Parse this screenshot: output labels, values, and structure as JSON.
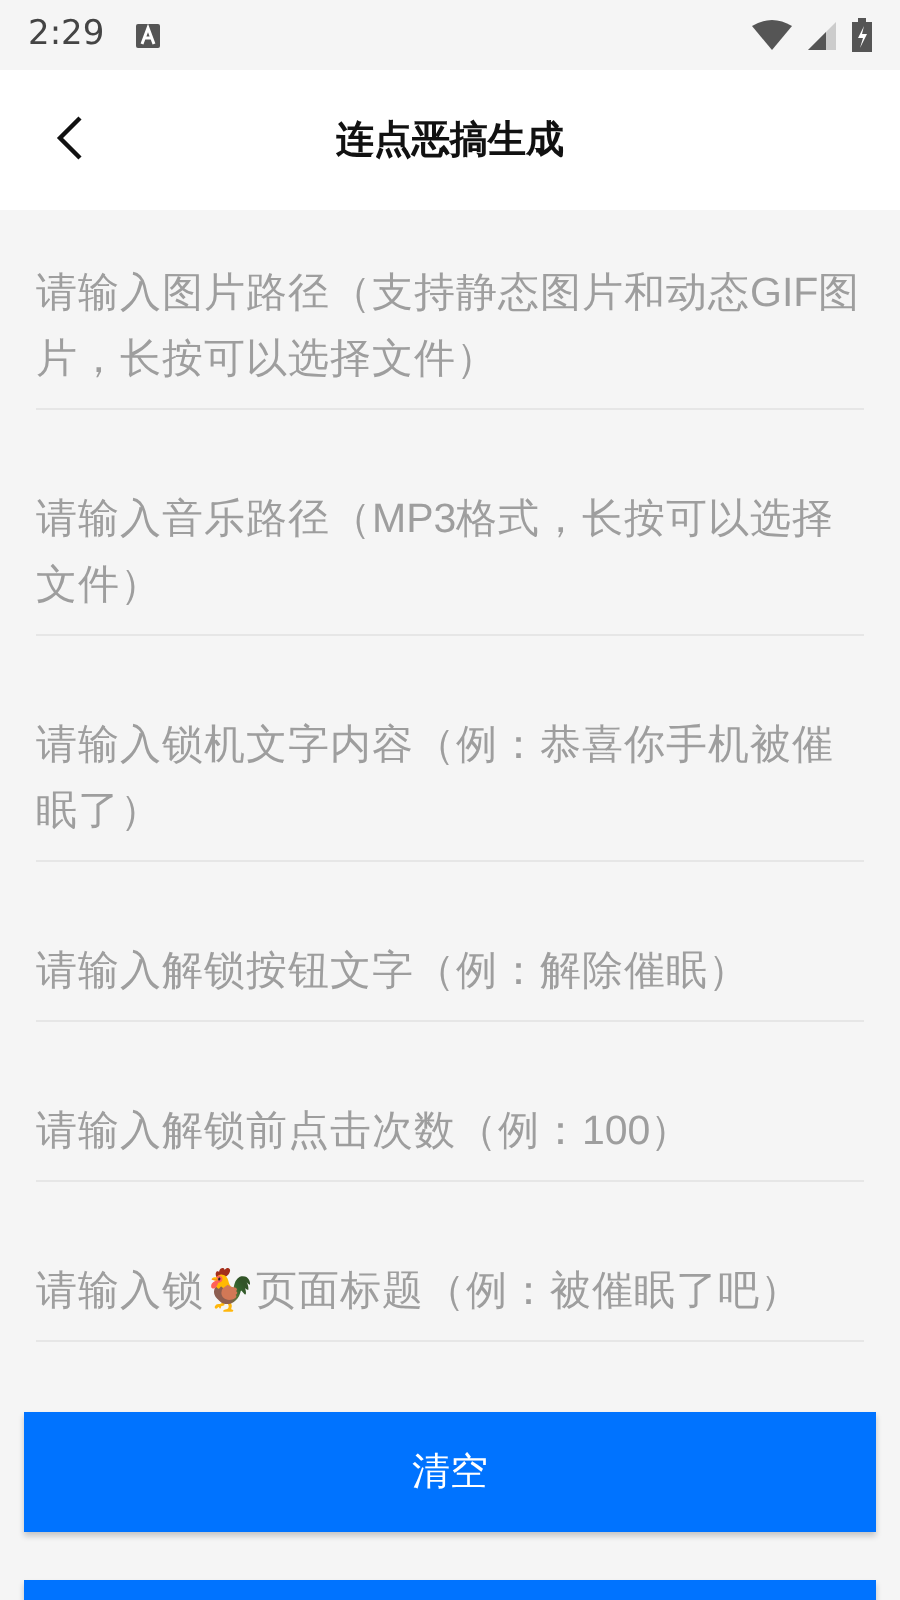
{
  "status_bar": {
    "time": "2:29"
  },
  "header": {
    "title": "连点恶搞生成"
  },
  "fields": [
    {
      "placeholder": "请输入图片路径（支持静态图片和动态GIF图片，长按可以选择文件）"
    },
    {
      "placeholder": "请输入音乐路径（MP3格式，长按可以选择文件）"
    },
    {
      "placeholder": "请输入锁机文字内容（例：恭喜你手机被催眠了）"
    },
    {
      "placeholder": "请输入解锁按钮文字（例：解除催眠）"
    },
    {
      "placeholder": "请输入解锁前点击次数（例：100）"
    },
    {
      "placeholder": "请输入锁🐓页面标题（例：被催眠了吧）"
    }
  ],
  "buttons": [
    {
      "kind": "labeled",
      "label": "清空"
    },
    {
      "kind": "cut"
    }
  ]
}
